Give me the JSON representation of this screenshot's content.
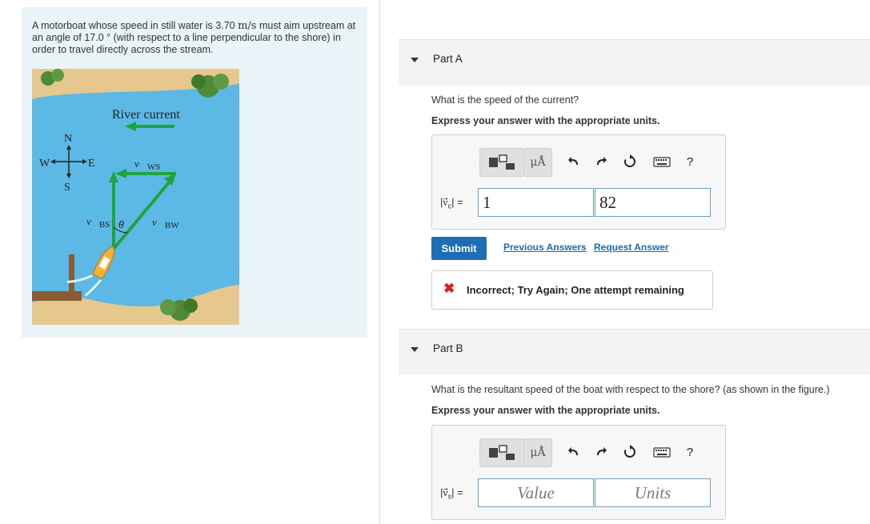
{
  "problem": {
    "text_before": "A motorboat whose speed in still water is 3.70 ",
    "unit": "m/s",
    "text_after": " must aim upstream at an angle of 17.0 ° (with respect to a line perpendicular to the shore) in order to travel directly across the stream."
  },
  "figure": {
    "river_current_label": "River current",
    "compass": {
      "n": "N",
      "s": "S",
      "e": "E",
      "w": "W"
    },
    "vec_ws": "WS",
    "vec_bs": "BS",
    "vec_bw": "BW",
    "theta": "θ",
    "colors": {
      "water": "#5cb8e4",
      "land": "#e6c88f",
      "arrow": "#1fa33a",
      "tree": "#4f8a38"
    }
  },
  "part_a": {
    "title": "Part A",
    "question": "What is the speed of the current?",
    "instruction": "Express your answer with the appropriate units.",
    "label_vec": "v",
    "label_sub": "c",
    "value": "1",
    "units": "82",
    "toolbar": {
      "units_icon": "μÅ",
      "undo_icon": "undo-arrow",
      "redo_icon": "redo-arrow",
      "reset_icon": "reset-circle",
      "keyboard_icon": "keyboard",
      "help_label": "?"
    },
    "submit_label": "Submit",
    "previous_answers_label": "Previous Answers",
    "request_answer_label": "Request Answer",
    "feedback": "Incorrect; Try Again; One attempt remaining"
  },
  "part_b": {
    "title": "Part B",
    "question": "What is the resultant speed of the boat with respect to the shore? (as shown in the figure.)",
    "instruction": "Express your answer with the appropriate units.",
    "label_vec": "v",
    "label_sub": "s",
    "value_placeholder": "Value",
    "units_placeholder": "Units",
    "toolbar": {
      "units_icon": "μÅ",
      "help_label": "?"
    }
  }
}
